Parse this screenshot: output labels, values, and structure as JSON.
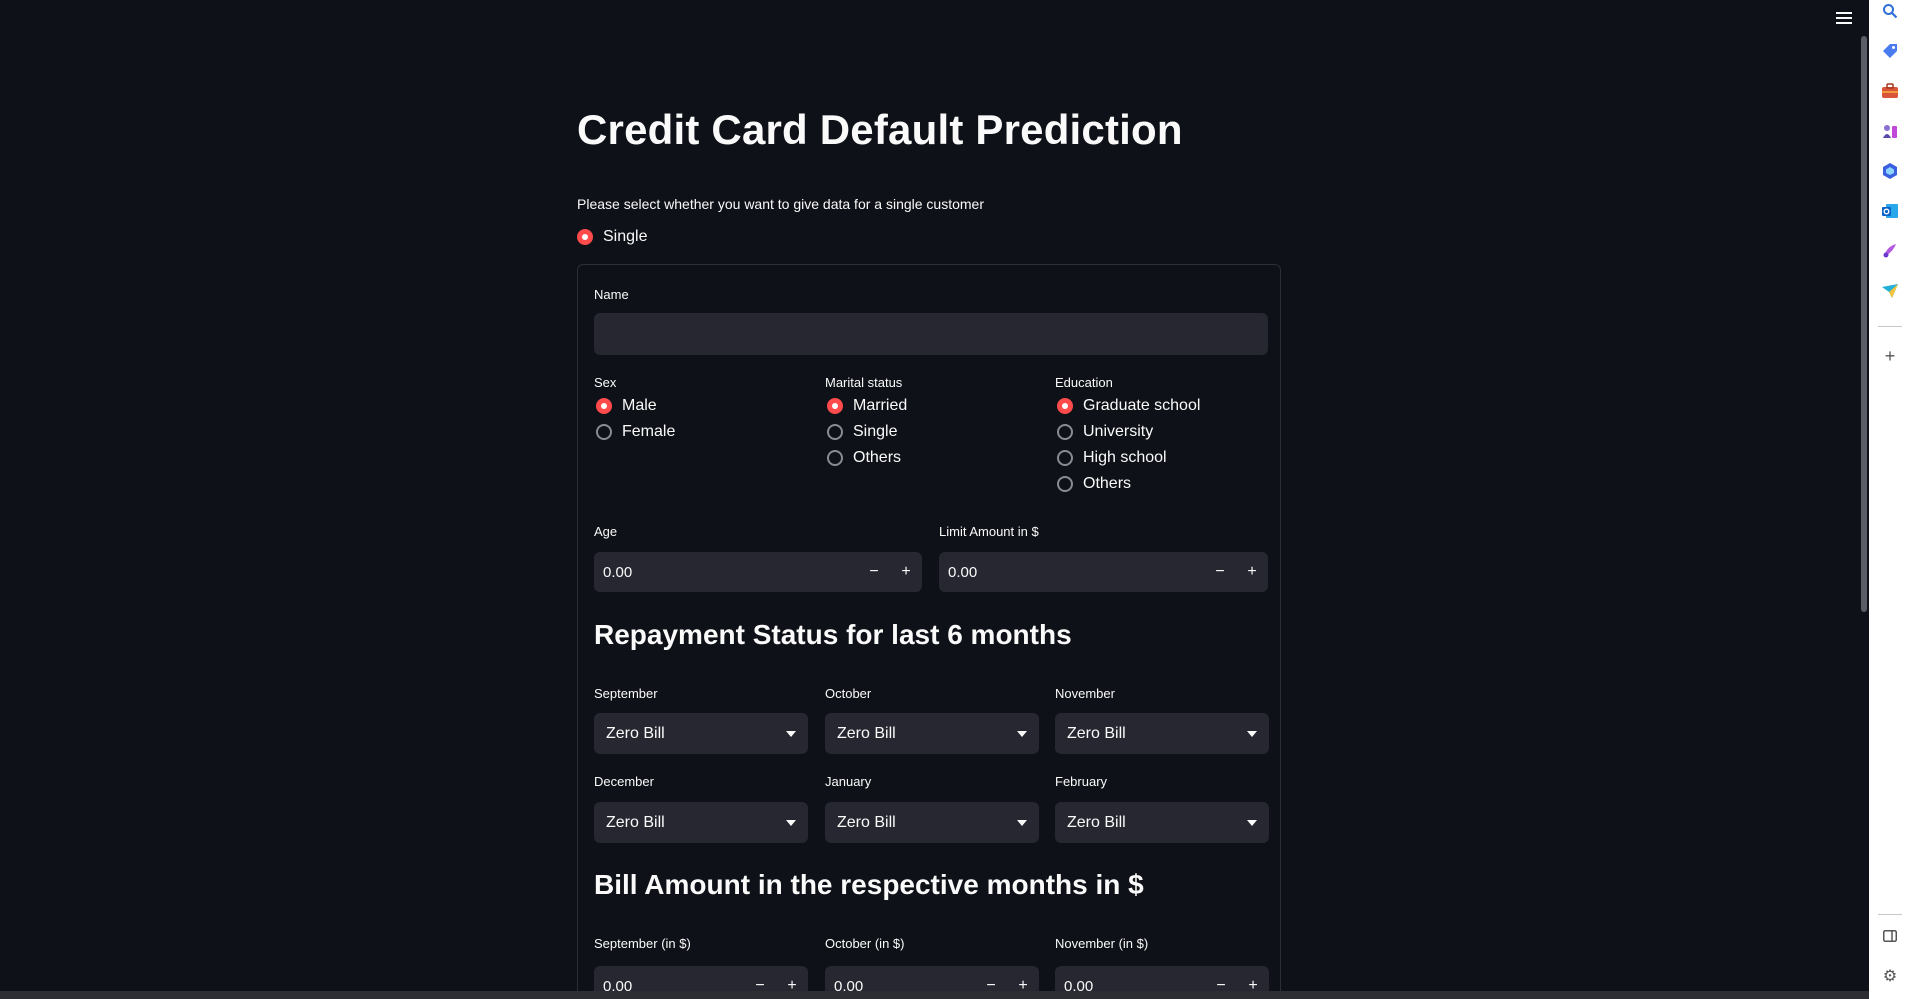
{
  "menu": {
    "icon": "hamburger-menu-icon"
  },
  "title": "Credit Card Default Prediction",
  "mode": {
    "question": "Please select whether you want to give data for a single customer",
    "options": [
      {
        "label": "Single",
        "selected": true
      }
    ]
  },
  "form": {
    "name": {
      "label": "Name",
      "value": ""
    },
    "sex": {
      "label": "Sex",
      "options": [
        "Male",
        "Female"
      ],
      "selected": "Male"
    },
    "marital": {
      "label": "Marital status",
      "options": [
        "Married",
        "Single",
        "Others"
      ],
      "selected": "Married"
    },
    "education": {
      "label": "Education",
      "options": [
        "Graduate school",
        "University",
        "High school",
        "Others"
      ],
      "selected": "Graduate school"
    },
    "age": {
      "label": "Age",
      "value": "0.00"
    },
    "limit": {
      "label": "Limit Amount in $",
      "value": "0.00"
    },
    "repayment": {
      "heading": "Repayment Status for last 6 months",
      "fields": [
        {
          "label": "September",
          "value": "Zero Bill"
        },
        {
          "label": "October",
          "value": "Zero Bill"
        },
        {
          "label": "November",
          "value": "Zero Bill"
        },
        {
          "label": "December",
          "value": "Zero Bill"
        },
        {
          "label": "January",
          "value": "Zero Bill"
        },
        {
          "label": "February",
          "value": "Zero Bill"
        }
      ]
    },
    "bill": {
      "heading": "Bill Amount in the respective months in $",
      "fields": [
        {
          "label": "September (in $)",
          "value": "0.00"
        },
        {
          "label": "October (in $)",
          "value": "0.00"
        },
        {
          "label": "November (in $)",
          "value": "0.00"
        }
      ]
    },
    "stepper": {
      "minus": "−",
      "plus": "+"
    }
  },
  "sidebar": {
    "icons": [
      "search-icon",
      "tag-icon",
      "briefcase-icon",
      "games-icon",
      "copilot-icon",
      "outlook-icon",
      "designer-icon",
      "send-icon",
      "add-icon",
      "split-screen-icon",
      "settings-icon"
    ],
    "glyphs": {
      "add": "+",
      "settings": "⚙"
    }
  },
  "colors": {
    "background": "#0e1117",
    "input": "#262730",
    "accent": "#ff4b4b",
    "text": "#fafafa"
  }
}
